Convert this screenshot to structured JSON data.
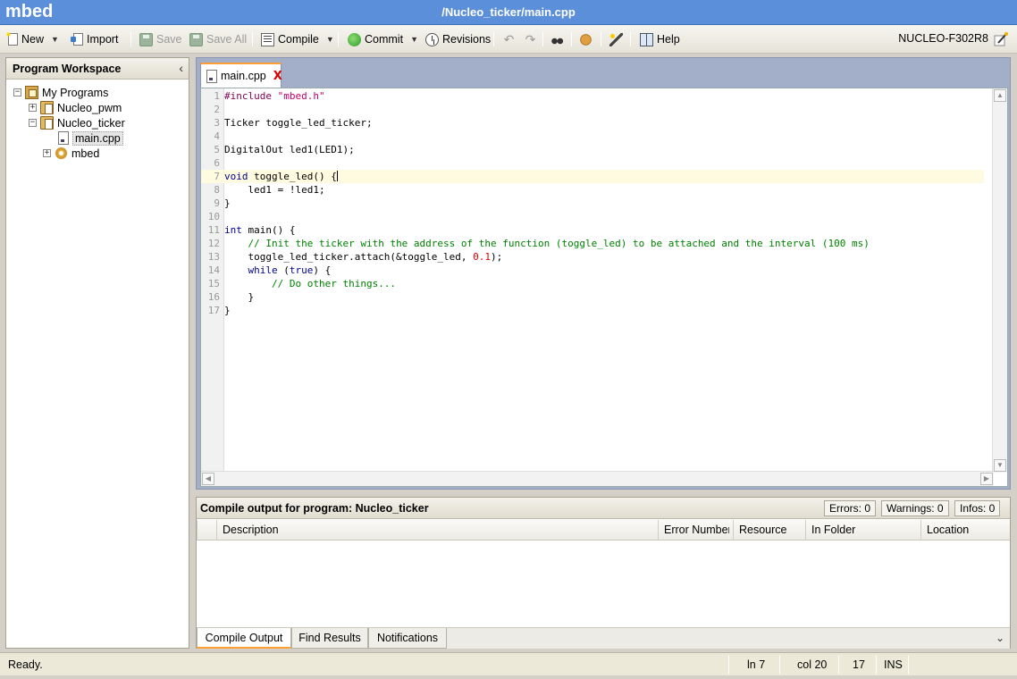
{
  "app": {
    "brand": "mbed",
    "window_title": "/Nucleo_ticker/main.cpp"
  },
  "toolbar": {
    "new_label": "New",
    "import_label": "Import",
    "save_label": "Save",
    "save_all_label": "Save All",
    "compile_label": "Compile",
    "commit_label": "Commit",
    "revisions_label": "Revisions",
    "help_label": "Help",
    "target_label": "NUCLEO-F302R8"
  },
  "workspace": {
    "title": "Program Workspace",
    "root": "My Programs",
    "programs": [
      {
        "label": "Nucleo_pwm",
        "expanded": false
      },
      {
        "label": "Nucleo_ticker",
        "expanded": true
      }
    ],
    "files": [
      {
        "label": "main.cpp",
        "selected": true
      },
      {
        "label": "mbed",
        "selected": false
      }
    ]
  },
  "editor": {
    "tab_label": "main.cpp",
    "tab_close": "X",
    "current_line": 7,
    "lines": [
      "#include \"mbed.h\"",
      "",
      "Ticker toggle_led_ticker;",
      "",
      "DigitalOut led1(LED1);",
      "",
      "void toggle_led() {",
      "    led1 = !led1;",
      "}",
      "",
      "int main() {",
      "    // Init the ticker with the address of the function (toggle_led) to be attached and the interval (100 ms)",
      "    toggle_led_ticker.attach(&toggle_led, 0.1);",
      "    while (true) {",
      "        // Do other things...",
      "    }",
      "}"
    ]
  },
  "output": {
    "title": "Compile output for program: Nucleo_ticker",
    "errors": "Errors: 0",
    "warnings": "Warnings: 0",
    "infos": "Infos: 0",
    "columns": [
      "Description",
      "Error Number",
      "Resource",
      "In Folder",
      "Location"
    ],
    "tabs": [
      "Compile Output",
      "Find Results",
      "Notifications"
    ],
    "active_tab": 0
  },
  "status": {
    "message": "Ready.",
    "line": "ln 7",
    "col": "col 20",
    "count": "17",
    "mode": "INS"
  }
}
